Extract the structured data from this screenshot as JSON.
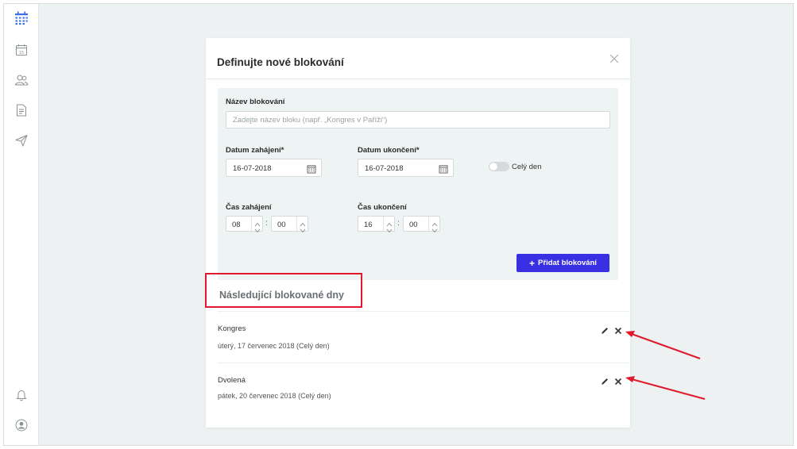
{
  "sidebar": {
    "items": [
      {
        "icon": "calendar-grid-icon",
        "color": "#3a6fe8"
      },
      {
        "icon": "calendar-day-icon",
        "label": "15"
      },
      {
        "icon": "users-icon"
      },
      {
        "icon": "document-icon"
      },
      {
        "icon": "send-icon"
      }
    ],
    "bottom": [
      {
        "icon": "bell-icon"
      },
      {
        "icon": "user-account-icon"
      }
    ]
  },
  "modal": {
    "title": "Definujte nové blokování",
    "form": {
      "name_label": "Název blokování",
      "name_placeholder": "Zadejte název bloku (např. „Kongres v Paříži“)",
      "start_date_label": "Datum zahájení*",
      "start_date_value": "16-07-2018",
      "end_date_label": "Datum ukončení*",
      "end_date_value": "16-07-2018",
      "all_day_label": "Celý den",
      "start_time_label": "Čas zahájení",
      "start_hour": "08",
      "start_minute": "00",
      "end_time_label": "Čas ukončení",
      "end_hour": "16",
      "end_minute": "00",
      "time_separator": ":",
      "add_button_label": "Přidat blokování",
      "add_button_icon": "+"
    },
    "list_title": "Následující blokované dny",
    "blocks": [
      {
        "name": "Kongres",
        "date": "úterý, 17 červenec 2018 (Celý den)"
      },
      {
        "name": "Dvolená",
        "date": "pátek, 20 červenec 2018 (Celý den)"
      }
    ]
  },
  "colors": {
    "accent": "#3a30e3",
    "annotation": "#e0192c",
    "background": "#edf1f1"
  }
}
